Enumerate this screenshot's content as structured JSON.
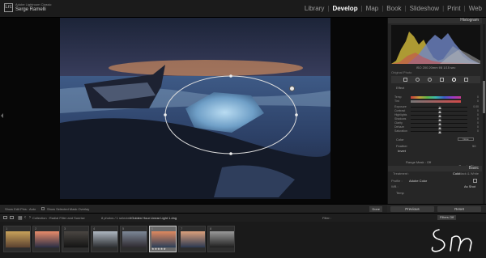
{
  "app": {
    "name": "Adobe Lightroom Classic",
    "user": "Serge Ramelli",
    "logo": "Lrc"
  },
  "modules": [
    "Library",
    "Develop",
    "Map",
    "Book",
    "Slideshow",
    "Print",
    "Web"
  ],
  "active_module": "Develop",
  "panel": {
    "histogram_title": "Histogram",
    "histogram_stats": "ISO 200   20mm   f/8   1/15 sec",
    "original_photo": "Original Photo",
    "mask_label": "Effect",
    "sliders": [
      {
        "label": "Temp",
        "value": "0"
      },
      {
        "label": "Tint",
        "value": "0"
      },
      {
        "label": "Exposure",
        "value": "0.00"
      },
      {
        "label": "Contrast",
        "value": "0"
      },
      {
        "label": "Highlights",
        "value": "0"
      },
      {
        "label": "Shadows",
        "value": "0"
      },
      {
        "label": "Clarity",
        "value": "0"
      },
      {
        "label": "Dehaze",
        "value": "0"
      },
      {
        "label": "Saturation",
        "value": "0"
      },
      {
        "label": "Sharpness",
        "value": "0"
      },
      {
        "label": "Noise",
        "value": "0"
      },
      {
        "label": "Moire",
        "value": "0"
      },
      {
        "label": "Defringe",
        "value": "0"
      }
    ],
    "color_label": "Color",
    "color_value": "None",
    "feather_label": "Feather",
    "feather_value": "50",
    "invert_label": "Invert",
    "range_mask_label": "Range Mask :",
    "range_mask_value": "Off",
    "reset_label": "Reset",
    "close_label": "Close",
    "basic_title": "Basic",
    "treatment_label": "Treatment :",
    "treatment_color": "Color",
    "treatment_bw": "Black & White",
    "profile_label": "Profile :",
    "profile_value": "Adobe Color",
    "wb_label": "WB :",
    "wb_value": "As Shot",
    "temp_label": "Temp",
    "previous_label": "Previous",
    "reset_button_label": "Reset"
  },
  "toolbar": {
    "show_edit_pins_label": "Show Edit Pins :",
    "show_edit_pins_value": "Auto",
    "show_overlay_label": "Show Selected Mask Overlay",
    "done_label": "Done"
  },
  "filmstrip_bar": {
    "collection": "Collection : Radial Filter and Sunrise",
    "count": "8 photos / 1 selected",
    "selected_file": "/ Golden Hour Linear Light 1.dng",
    "filter_label": "Filter :",
    "filter_value": "Filters Off"
  },
  "thumbnails": [
    {
      "num": "1",
      "rating": "",
      "selected": false,
      "colors": [
        "#c9a25a",
        "#5b4230"
      ]
    },
    {
      "num": "2",
      "rating": "",
      "selected": false,
      "colors": [
        "#e98c6b",
        "#2a2e44"
      ]
    },
    {
      "num": "3",
      "rating": "",
      "selected": false,
      "colors": [
        "#4a4642",
        "#141414"
      ]
    },
    {
      "num": "4",
      "rating": "",
      "selected": false,
      "colors": [
        "#aeb7c1",
        "#2b2d30"
      ]
    },
    {
      "num": "5",
      "rating": "",
      "selected": false,
      "colors": [
        "#7d8897",
        "#2e2a30"
      ]
    },
    {
      "num": "6",
      "rating": "★★★★★",
      "selected": true,
      "colors": [
        "#e0895f",
        "#2c3e58"
      ]
    },
    {
      "num": "7",
      "rating": "",
      "selected": false,
      "colors": [
        "#dba07c",
        "#2b3850"
      ]
    },
    {
      "num": "8",
      "rating": "",
      "selected": false,
      "colors": [
        "#9a9a9a",
        "#1f1f1f"
      ]
    }
  ],
  "colors": {
    "accent": "#ffffff",
    "panel_bg": "#262626"
  }
}
